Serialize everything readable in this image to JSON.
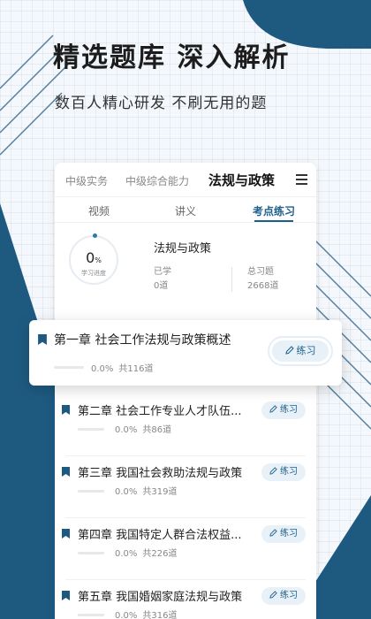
{
  "headline": "精选题库  深入解析",
  "subline": "数百人精心研发  不刷无用的题",
  "colors": {
    "accent": "#1f5f8a",
    "dark_blue": "#1e5a80",
    "button_bg": "#e8f1f8"
  },
  "tabs": [
    {
      "label": "中级实务"
    },
    {
      "label": "中级综合能力"
    },
    {
      "label": "法规与政策",
      "active": true
    }
  ],
  "menu_icon": "menu-icon",
  "subtabs": [
    {
      "label": "视频"
    },
    {
      "label": "讲义"
    },
    {
      "label": "考点练习",
      "active": true
    }
  ],
  "progress": {
    "value": "0",
    "unit": "%",
    "label": "学习进度",
    "percent": 0
  },
  "stats": {
    "title": "法规与政策",
    "learned_label": "已学",
    "learned_value": "0道",
    "total_label": "总习题",
    "total_value": "2668道"
  },
  "highlight_chapter": {
    "title": "第一章  社会工作法规与政策概述",
    "percent": "0.0%",
    "count": "共116道",
    "button": "练习"
  },
  "chapters": [
    {
      "title": "第二章  社会工作专业人才队伍...",
      "percent": "0.0%",
      "count": "共86道",
      "button": "练习"
    },
    {
      "title": "第三章  我国社会救助法规与政策",
      "percent": "0.0%",
      "count": "共319道",
      "button": "练习"
    },
    {
      "title": "第四章  我国特定人群合法权益...",
      "percent": "0.0%",
      "count": "共226道",
      "button": "练习"
    },
    {
      "title": "第五章  我国婚姻家庭法规与政策",
      "percent": "0.0%",
      "count": "共316道",
      "button": "练习"
    }
  ]
}
